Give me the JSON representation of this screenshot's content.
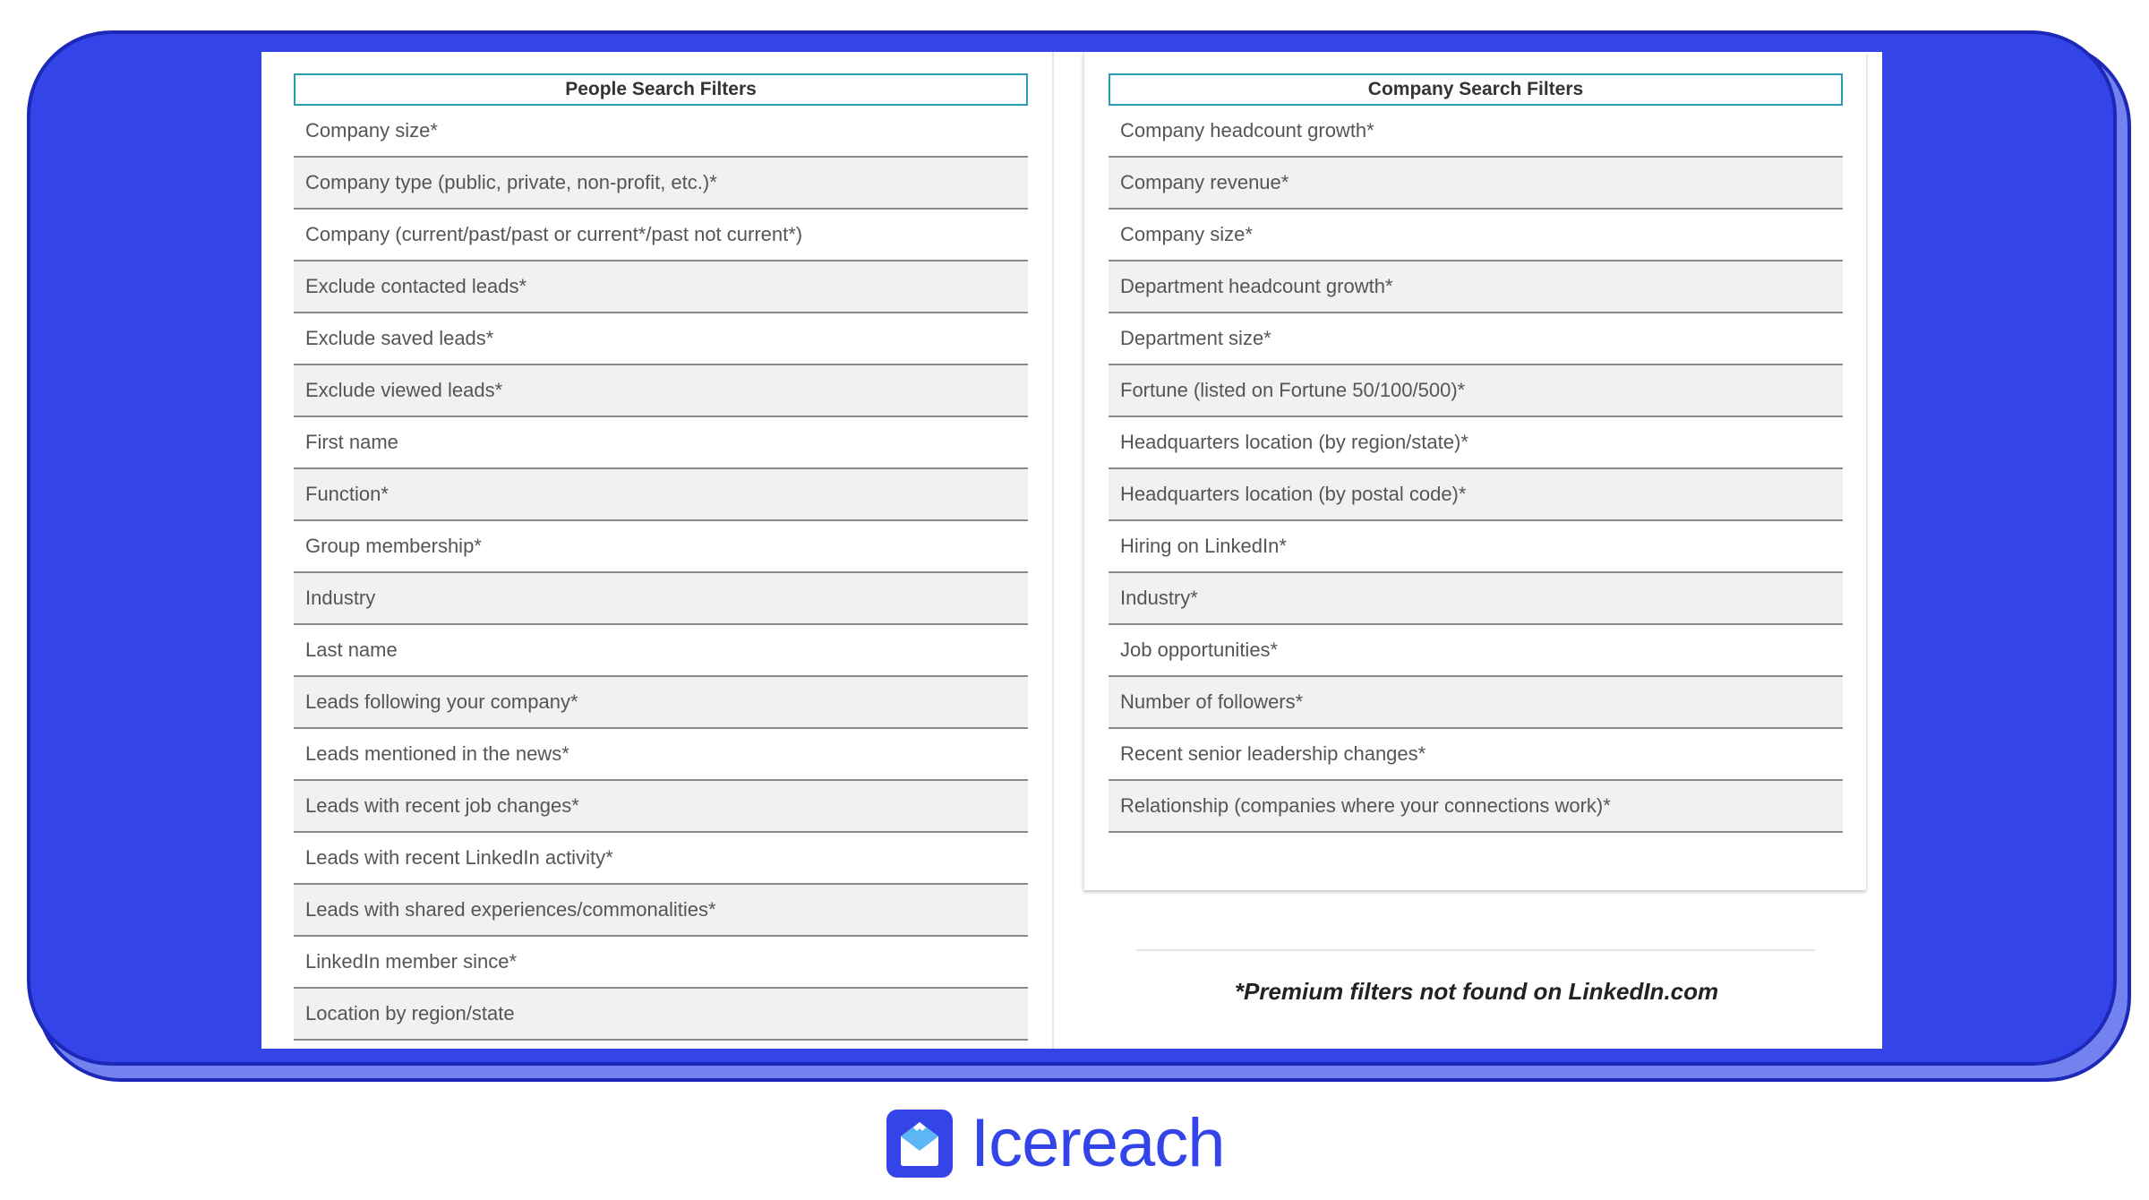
{
  "people": {
    "title": "People Search Filters",
    "rows": [
      "Company size*",
      "Company type (public, private, non-profit, etc.)*",
      "Company (current/past/past or current*/past not current*)",
      "Exclude contacted leads*",
      "Exclude saved leads*",
      "Exclude viewed leads*",
      "First name",
      "Function*",
      "Group membership*",
      "Industry",
      "Last name",
      "Leads following your company*",
      "Leads mentioned in the news*",
      "Leads with recent job changes*",
      "Leads with recent LinkedIn activity*",
      "Leads with shared experiences/commonalities*",
      "LinkedIn member since*",
      "Location by region/state"
    ]
  },
  "company": {
    "title": "Company Search Filters",
    "rows": [
      "Company headcount growth*",
      "Company revenue*",
      "Company size*",
      "Department headcount growth*",
      "Department size*",
      "Fortune (listed on Fortune 50/100/500)*",
      "Headquarters location (by region/state)*",
      "Headquarters location (by postal code)*",
      "Hiring on LinkedIn*",
      "Industry*",
      "Job opportunities*",
      "Number of followers*",
      "Recent senior leadership changes*",
      "Relationship (companies where your connections work)*"
    ]
  },
  "footnote": "*Premium filters not found on LinkedIn.com",
  "brand": {
    "name": "Icereach",
    "icon": "envelope-mountain-icon",
    "color": "#3344e8"
  },
  "colors": {
    "frame": "#3344e8",
    "header_border": "#2a9bb5",
    "alt_row": "#f1f1f1"
  }
}
